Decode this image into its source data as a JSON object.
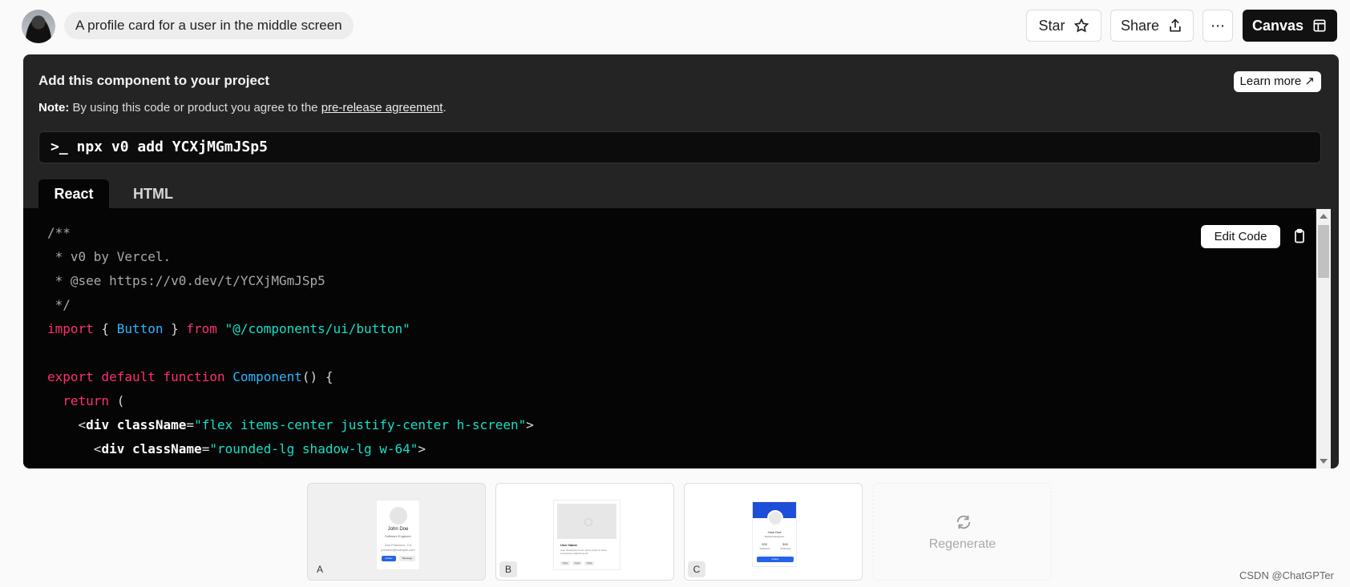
{
  "header": {
    "prompt_text": "A profile card for a user in the middle screen",
    "star_label": "Star",
    "share_label": "Share",
    "more_label": "⋯",
    "canvas_label": "Canvas"
  },
  "panel": {
    "title": "Add this component to your project",
    "note_label": "Note:",
    "note_text": " By using this code or product you agree to the ",
    "note_link": "pre-release agreement",
    "note_end": ".",
    "learn_more": "Learn more ↗",
    "command": ">_ npx v0 add YCXjMGmJSp5",
    "tabs": [
      "React",
      "HTML"
    ],
    "edit_code_label": "Edit Code"
  },
  "code_lines": [
    "/**",
    " * v0 by Vercel.",
    " * @see https://v0.dev/t/YCXjMGmJSp5",
    " */",
    "import { Button } from \"@/components/ui/button\"",
    "",
    "export default function Component() {",
    "  return (",
    "    <div className=\"flex items-center justify-center h-screen\">",
    "      <div className=\"rounded-lg shadow-lg w-64\">"
  ],
  "variants": {
    "a_label": "A",
    "b_label": "B",
    "c_label": "C",
    "a_name": "John Doe",
    "a_role": "Software Engineer",
    "a_location": "San Francisco, CA",
    "a_email": "johndoe@example.com",
    "a_primary": "Follow",
    "a_secondary": "Message",
    "b_name": "User Name",
    "b_desc": "User description lorem ipsum dolor sit amet, consectetur adipiscing elit.",
    "b_tags": [
      "Tag1",
      "Tag2",
      "Tag3"
    ],
    "c_name": "John Doe",
    "c_role": "Software Engineer",
    "c_stats": [
      "200",
      "300"
    ],
    "c_stat_labels": [
      "Followers",
      "Following"
    ],
    "c_button": "Follow",
    "regenerate_label": "Regenerate"
  },
  "watermark": "CSDN @ChatGPTer"
}
